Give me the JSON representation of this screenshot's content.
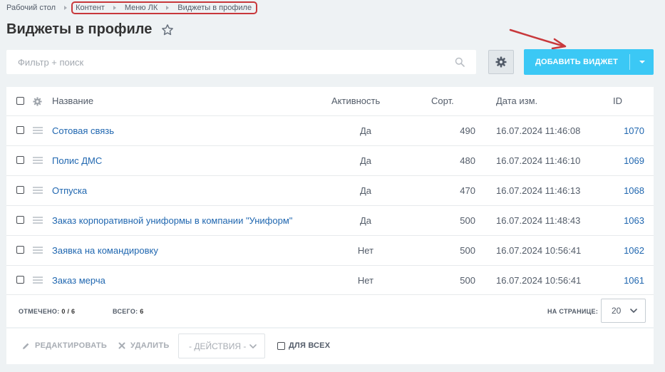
{
  "breadcrumb": {
    "items": [
      "Рабочий стол",
      "Контент",
      "Меню ЛК",
      "Виджеты в профиле"
    ]
  },
  "page": {
    "title": "Виджеты в профиле"
  },
  "search": {
    "placeholder": "Фильтр + поиск",
    "value": ""
  },
  "toolbar": {
    "add_label": "ДОБАВИТЬ ВИДЖЕТ"
  },
  "grid": {
    "columns": {
      "name": "Название",
      "active": "Активность",
      "sort": "Сорт.",
      "date": "Дата изм.",
      "id": "ID"
    },
    "rows": [
      {
        "name": "Сотовая связь",
        "active": "Да",
        "sort": "490",
        "date": "16.07.2024 11:46:08",
        "id": "1070"
      },
      {
        "name": "Полис ДМС",
        "active": "Да",
        "sort": "480",
        "date": "16.07.2024 11:46:10",
        "id": "1069"
      },
      {
        "name": "Отпуска",
        "active": "Да",
        "sort": "470",
        "date": "16.07.2024 11:46:13",
        "id": "1068"
      },
      {
        "name": "Заказ корпоративной униформы в компании \"Униформ\"",
        "active": "Да",
        "sort": "500",
        "date": "16.07.2024 11:48:43",
        "id": "1063"
      },
      {
        "name": "Заявка на командировку",
        "active": "Нет",
        "sort": "500",
        "date": "16.07.2024 10:56:41",
        "id": "1062"
      },
      {
        "name": "Заказ мерча",
        "active": "Нет",
        "sort": "500",
        "date": "16.07.2024 10:56:41",
        "id": "1061"
      }
    ]
  },
  "footer": {
    "selected_label": "ОТМЕЧЕНО:",
    "selected_value": "0 / 6",
    "total_label": "ВСЕГО:",
    "total_value": "6",
    "page_size_label": "НА СТРАНИЦЕ:",
    "page_size_value": "20"
  },
  "actions": {
    "edit_label": "РЕДАКТИРОВАТЬ",
    "delete_label": "УДАЛИТЬ",
    "select_value": "- ДЕЙСТВИЯ -",
    "for_all_label": "ДЛЯ ВСЕХ"
  },
  "colors": {
    "background": "#eef2f4",
    "accent_button": "#3bc8f5",
    "link": "#2067b0",
    "highlight": "#c8383b"
  },
  "icons": [
    "star-icon",
    "search-icon",
    "gear-icon",
    "drag-handle-icon",
    "pencil-icon",
    "close-icon",
    "chevron-down-icon",
    "red-arrow"
  ]
}
